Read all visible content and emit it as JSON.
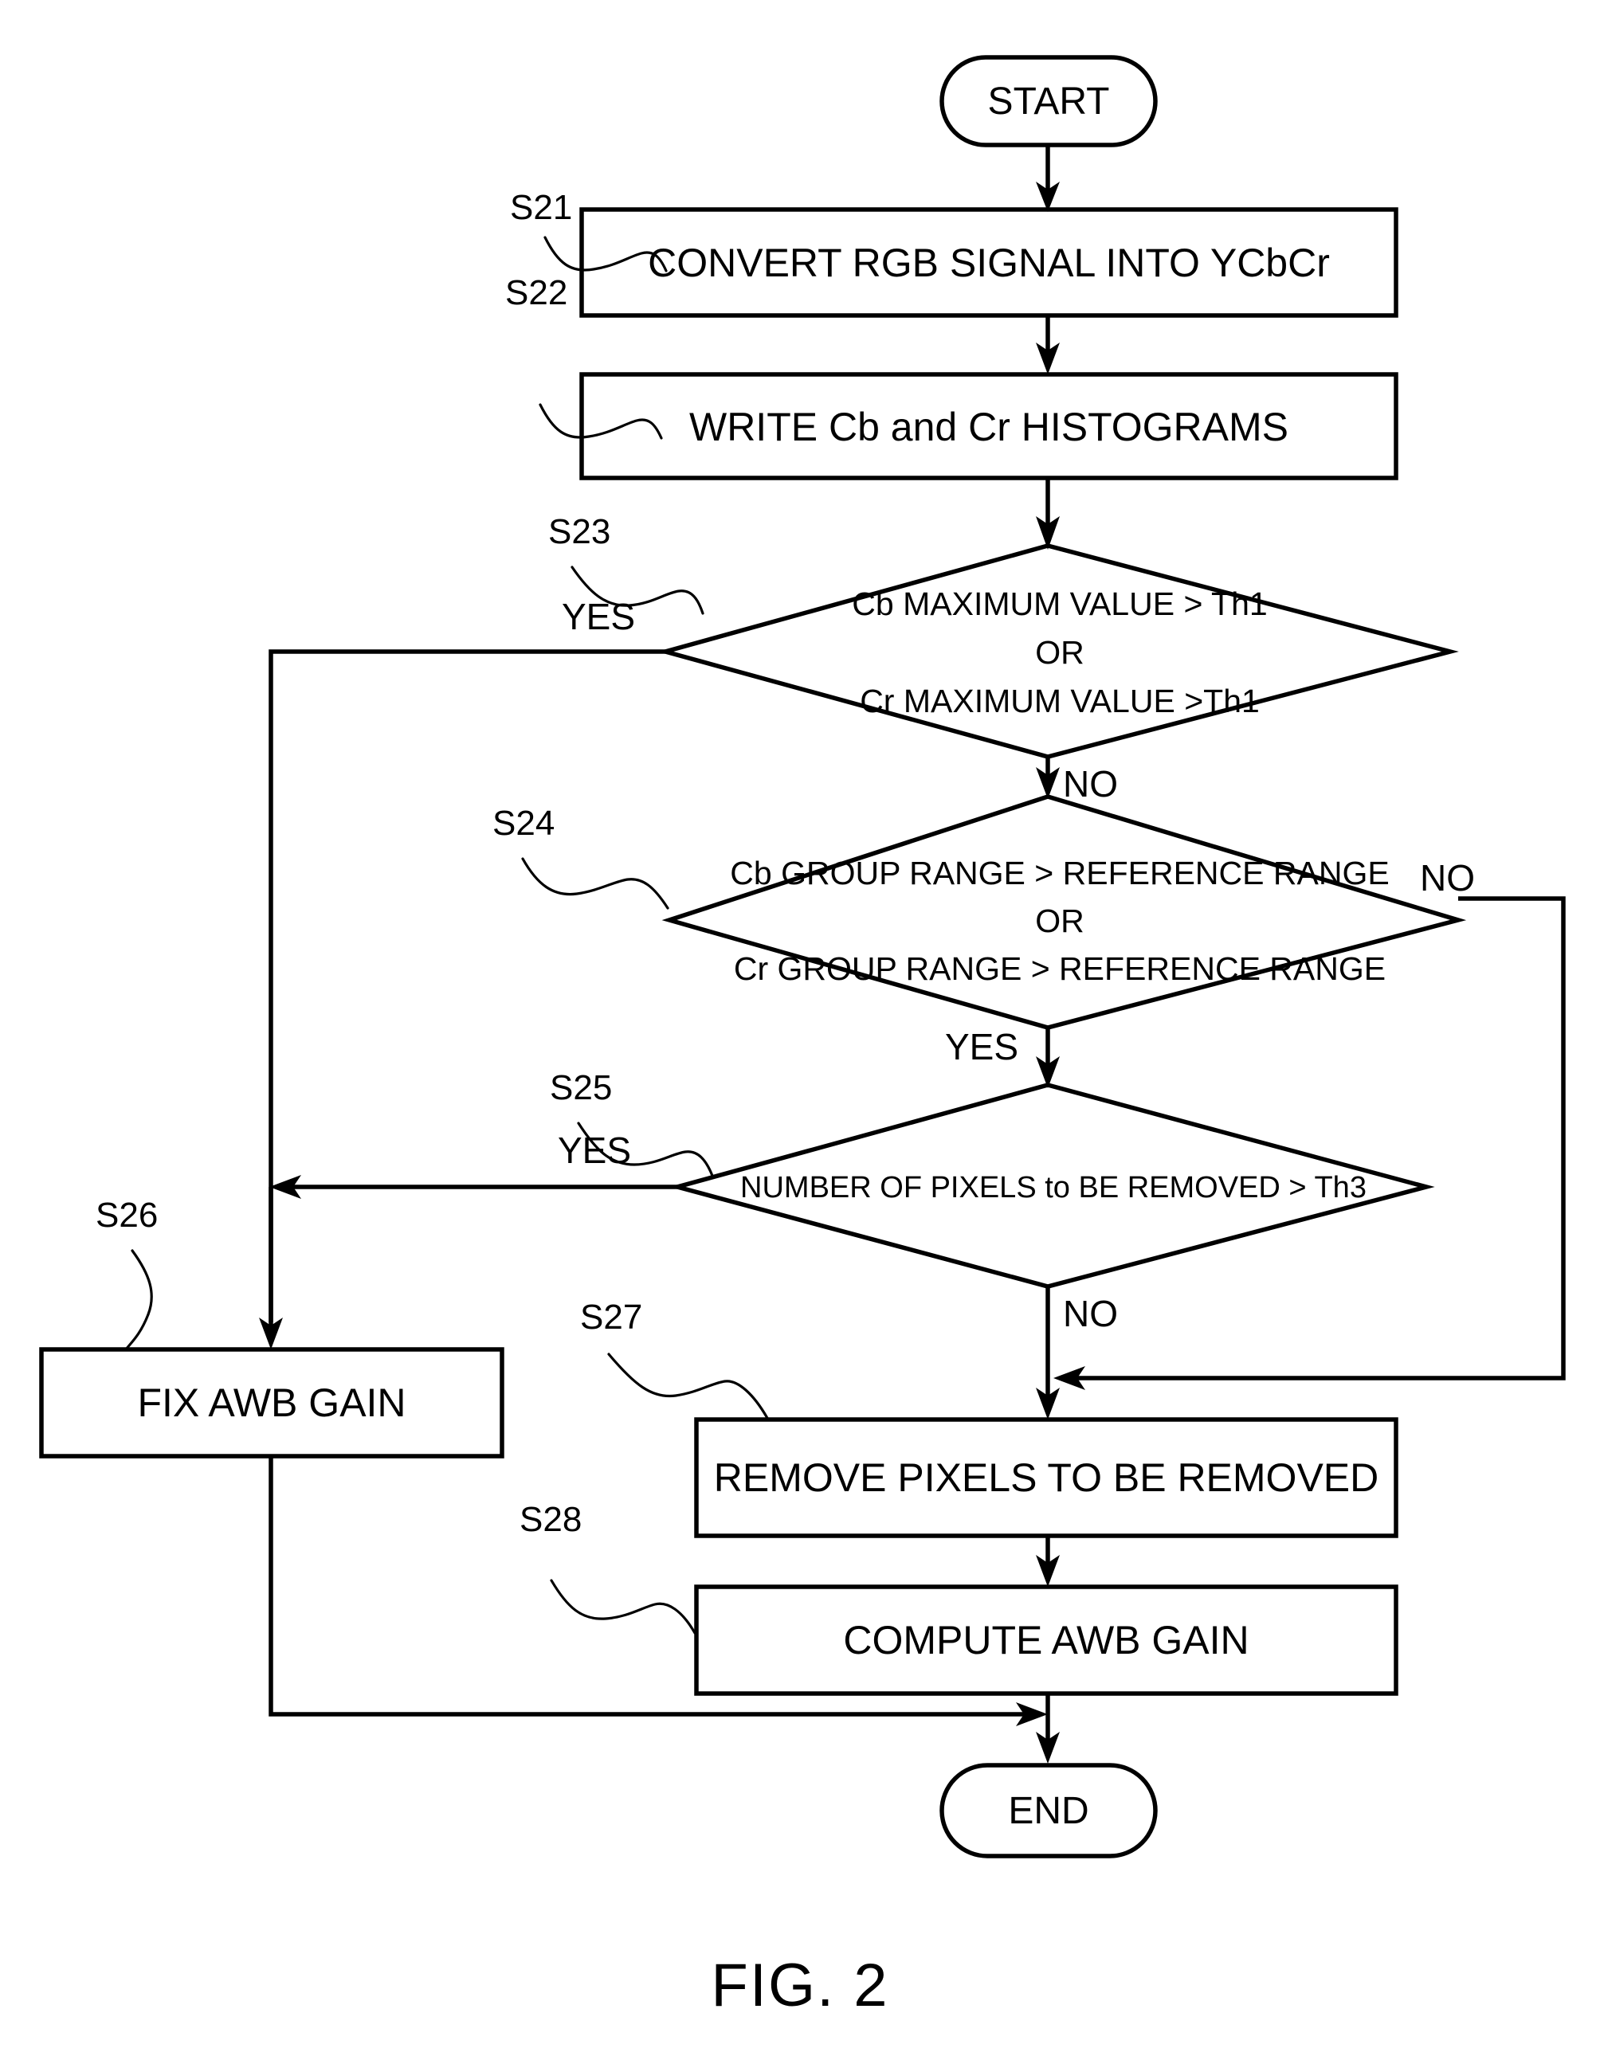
{
  "figure": {
    "caption": "FIG. 2",
    "title": "Automatic White Balance flowchart"
  },
  "terminators": {
    "start": "START",
    "end": "END"
  },
  "nodes": [
    {
      "id": "S21",
      "step_label": "S21",
      "kind": "process",
      "text": "CONVERT RGB SIGNAL INTO YCbCr"
    },
    {
      "id": "S22",
      "step_label": "S22",
      "kind": "process",
      "text": "WRITE Cb and Cr HISTOGRAMS"
    },
    {
      "id": "S23",
      "step_label": "S23",
      "kind": "decision",
      "line1": "Cb MAXIMUM VALUE > Th1",
      "line2": "OR",
      "line3": "Cr MAXIMUM VALUE >Th1",
      "yes_label": "YES",
      "no_label": "NO"
    },
    {
      "id": "S24",
      "step_label": "S24",
      "kind": "decision",
      "line1": "Cb GROUP RANGE > REFERENCE RANGE",
      "line2": "OR",
      "line3": "Cr GROUP RANGE > REFERENCE RANGE",
      "yes_label": "YES",
      "no_label": "NO"
    },
    {
      "id": "S25",
      "step_label": "S25",
      "kind": "decision",
      "line1": "NUMBER OF PIXELS to BE REMOVED > Th3",
      "yes_label": "YES",
      "no_label": "NO"
    },
    {
      "id": "S26",
      "step_label": "S26",
      "kind": "process",
      "text": "FIX AWB GAIN"
    },
    {
      "id": "S27",
      "step_label": "S27",
      "kind": "process",
      "text": "REMOVE PIXELS TO BE REMOVED"
    },
    {
      "id": "S28",
      "step_label": "S28",
      "kind": "process",
      "text": "COMPUTE AWB GAIN"
    }
  ],
  "colors": {
    "stroke": "#000000",
    "background": "#ffffff",
    "text": "#000000"
  }
}
